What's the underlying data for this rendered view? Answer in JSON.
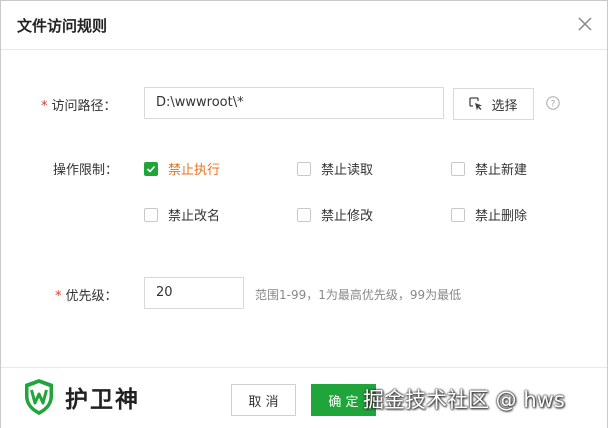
{
  "dialog": {
    "title": "文件访问规则"
  },
  "path_row": {
    "required_mark": "*",
    "label": "访问路径：",
    "value": "D:\\wwwroot\\*",
    "select_label": "选择"
  },
  "ops_row": {
    "label": "操作限制：",
    "options": [
      {
        "label": "禁止执行",
        "checked": true
      },
      {
        "label": "禁止读取",
        "checked": false
      },
      {
        "label": "禁止新建",
        "checked": false
      },
      {
        "label": "禁止改名",
        "checked": false
      },
      {
        "label": "禁止修改",
        "checked": false
      },
      {
        "label": "禁止删除",
        "checked": false
      }
    ]
  },
  "priority_row": {
    "required_mark": "*",
    "label": "优先级：",
    "value": "20",
    "hint": "范围1-99，1为最高优先级，99为最低"
  },
  "footer": {
    "brand": "护卫神",
    "cancel_label": "取 消",
    "ok_label": "确 定"
  },
  "watermark": "掘金技术社区 @ hws",
  "colors": {
    "accent": "#20a53a",
    "checked_text": "#e8721c",
    "required": "#e0362c"
  },
  "icons": {
    "close": "close-icon",
    "select": "cursor-select-icon",
    "help": "help-icon",
    "brand": "shield-w-logo-icon",
    "check": "check-icon"
  }
}
